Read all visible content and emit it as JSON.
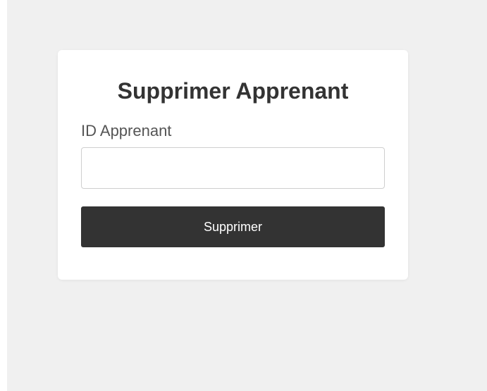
{
  "form": {
    "title": "Supprimer Apprenant",
    "id_label": "ID Apprenant",
    "id_value": "",
    "id_placeholder": "",
    "submit_label": "Supprimer"
  },
  "colors": {
    "background": "#f0f0f0",
    "card": "#ffffff",
    "button": "#333333",
    "button_text": "#ffffff",
    "title_text": "#333333",
    "label_text": "#555555"
  }
}
